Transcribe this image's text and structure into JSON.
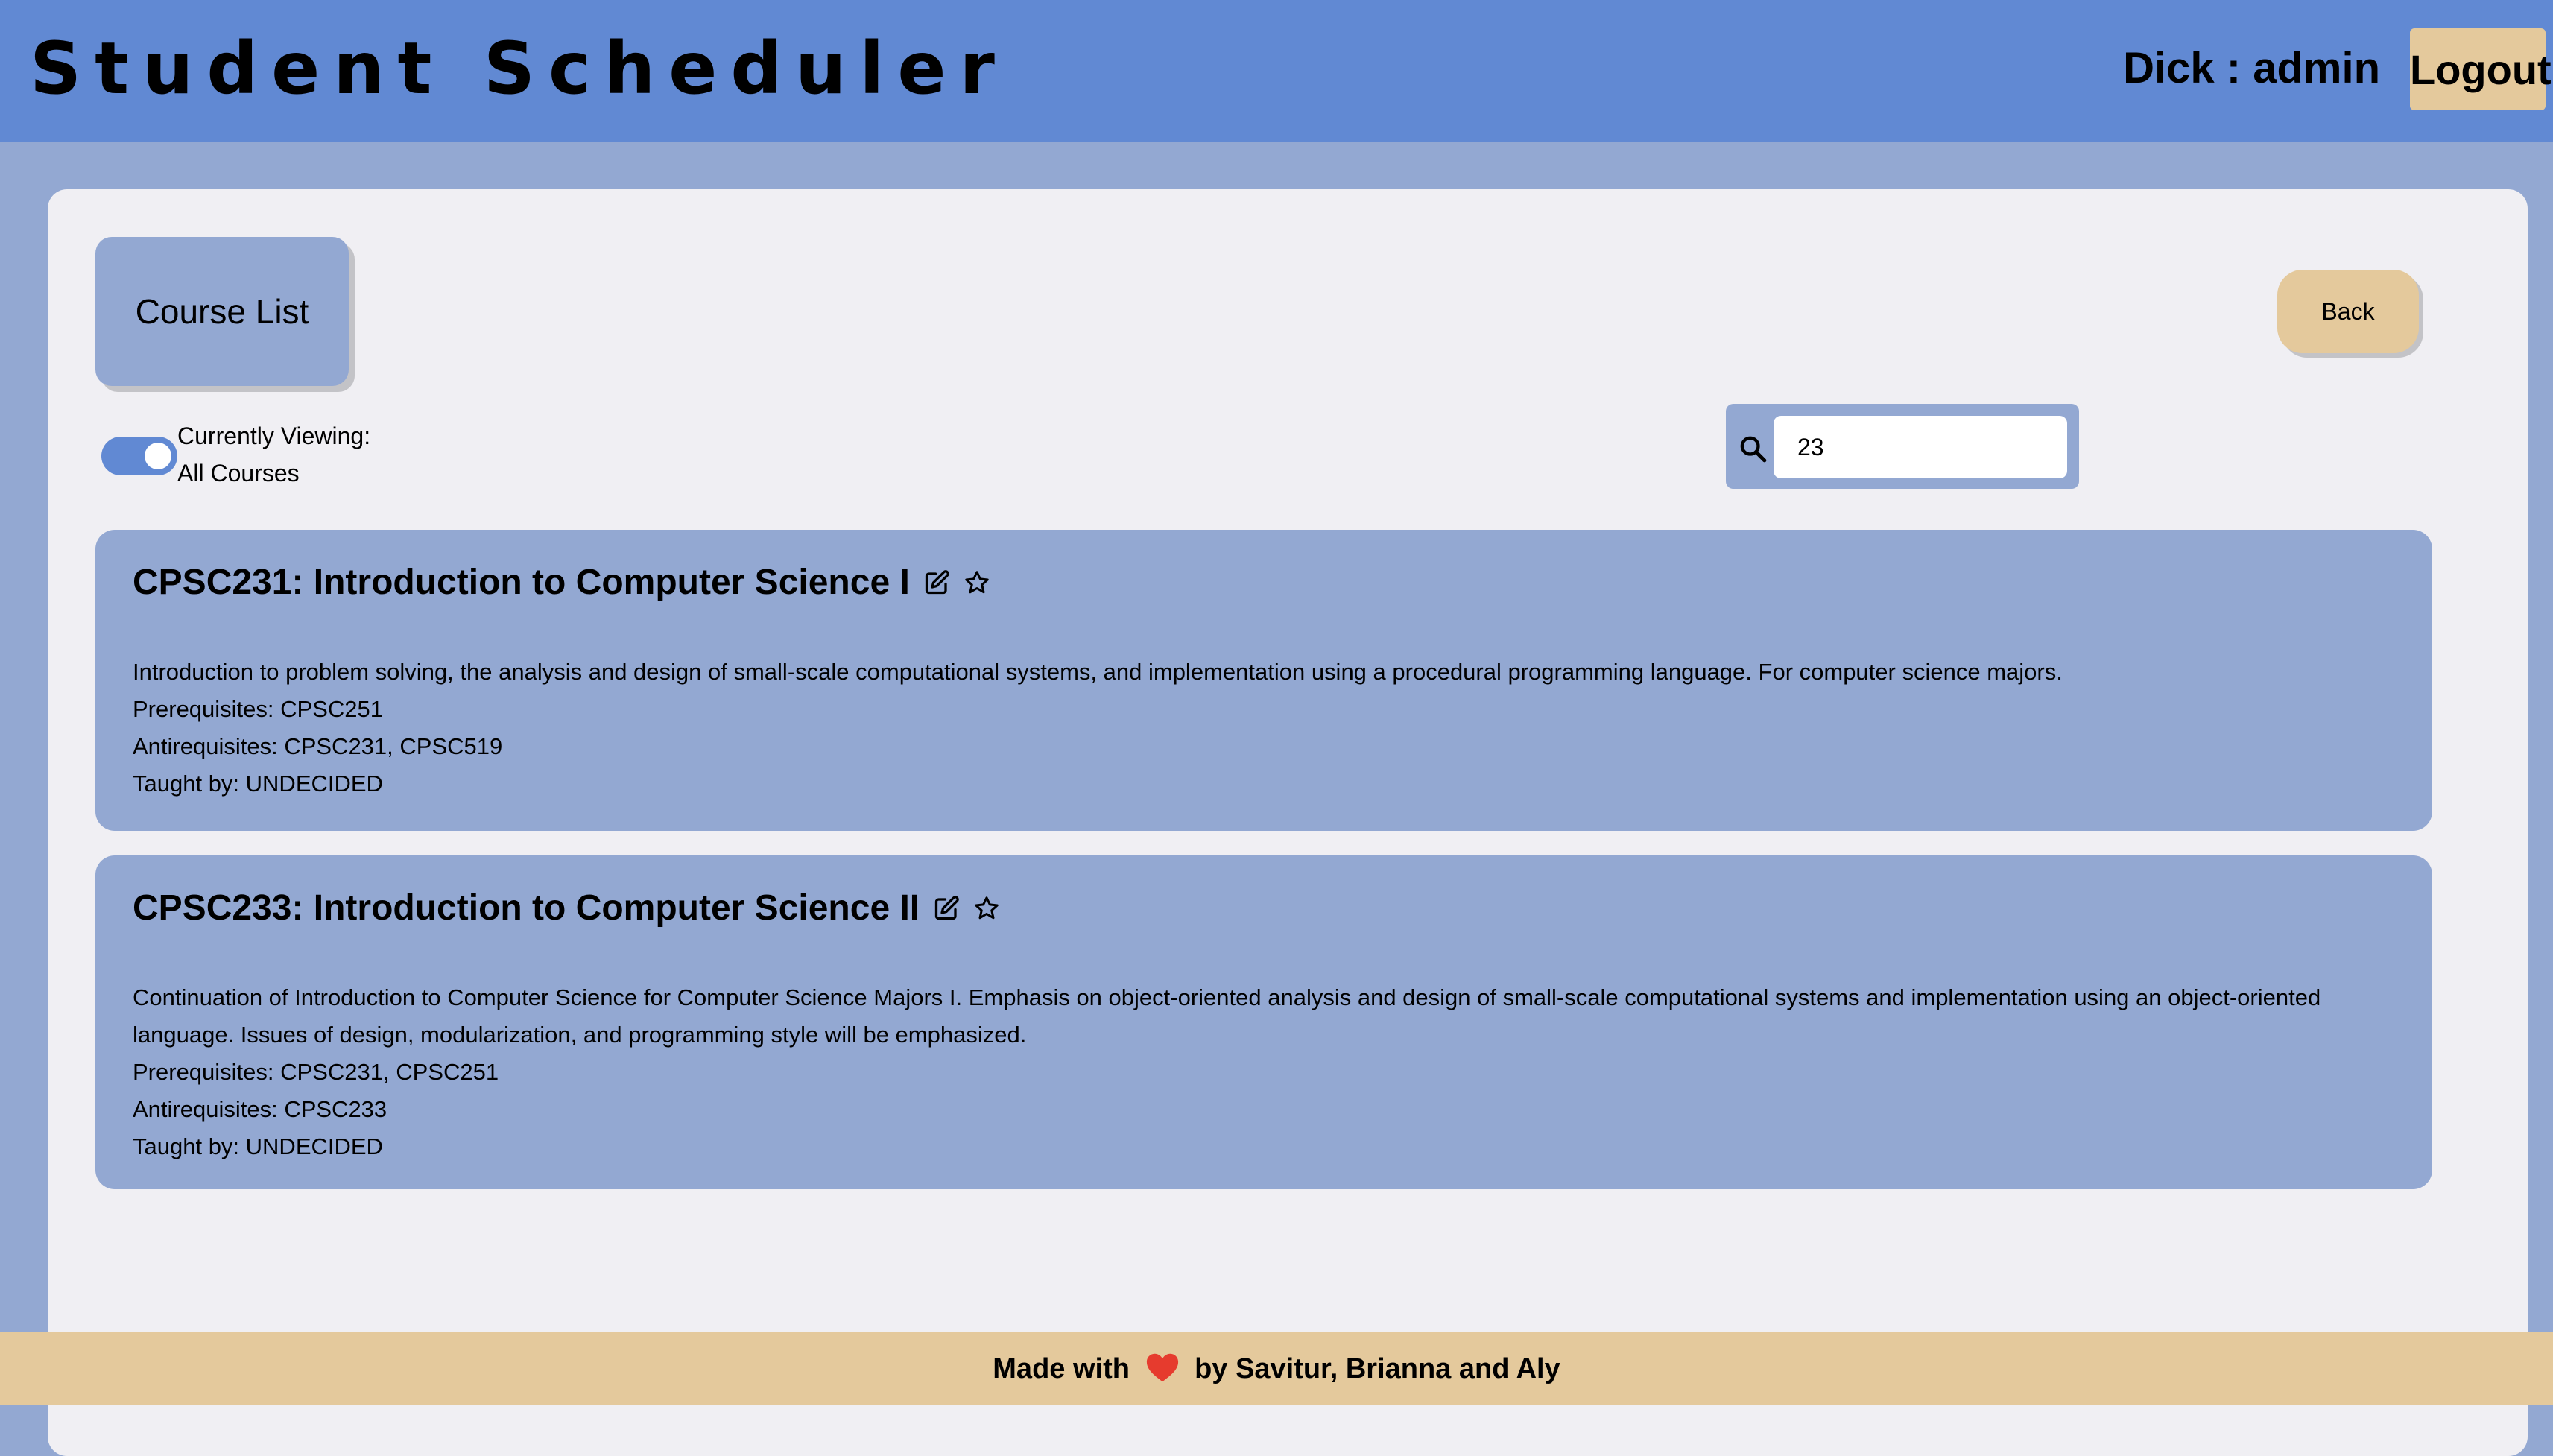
{
  "header": {
    "title": "Student Scheduler",
    "user_label": "Dick : admin",
    "logout_label": "Logout"
  },
  "toolbar": {
    "course_list_label": "Course List",
    "back_label": "Back",
    "view_toggle": {
      "on": true,
      "line1": "Currently Viewing:",
      "line2": "All Courses"
    },
    "search": {
      "value": "23",
      "placeholder": ""
    }
  },
  "courses": [
    {
      "title": "CPSC231: Introduction to Computer Science I",
      "description": "Introduction to problem solving, the analysis and design of small-scale computational systems, and implementation using a procedural programming language. For computer science majors.",
      "prerequisites": "Prerequisites: CPSC251",
      "antirequisites": "Antirequisites: CPSC231, CPSC519",
      "taught_by": "Taught by: UNDECIDED"
    },
    {
      "title": "CPSC233: Introduction to Computer Science II",
      "description": "Continuation of Introduction to Computer Science for Computer Science Majors I. Emphasis on object-oriented analysis and design of small-scale computational systems and implementation using an object-oriented language. Issues of design, modularization, and programming style will be emphasized.",
      "prerequisites": "Prerequisites: CPSC231, CPSC251",
      "antirequisites": "Antirequisites: CPSC233",
      "taught_by": "Taught by: UNDECIDED"
    }
  ],
  "footer": {
    "text_before": "Made with",
    "text_after": "by Savitur, Brianna and Aly"
  },
  "icons": {
    "search": "search-icon",
    "edit": "edit-icon",
    "favorite": "star-icon",
    "heart": "heart-icon"
  },
  "colors": {
    "header_bg": "#6189d3",
    "page_bg": "#93a8d2",
    "card_bg": "#f0eff3",
    "accent_tan": "#e4c99c",
    "course_card_bg": "#93a8d2",
    "heart": "#e63b2e"
  }
}
